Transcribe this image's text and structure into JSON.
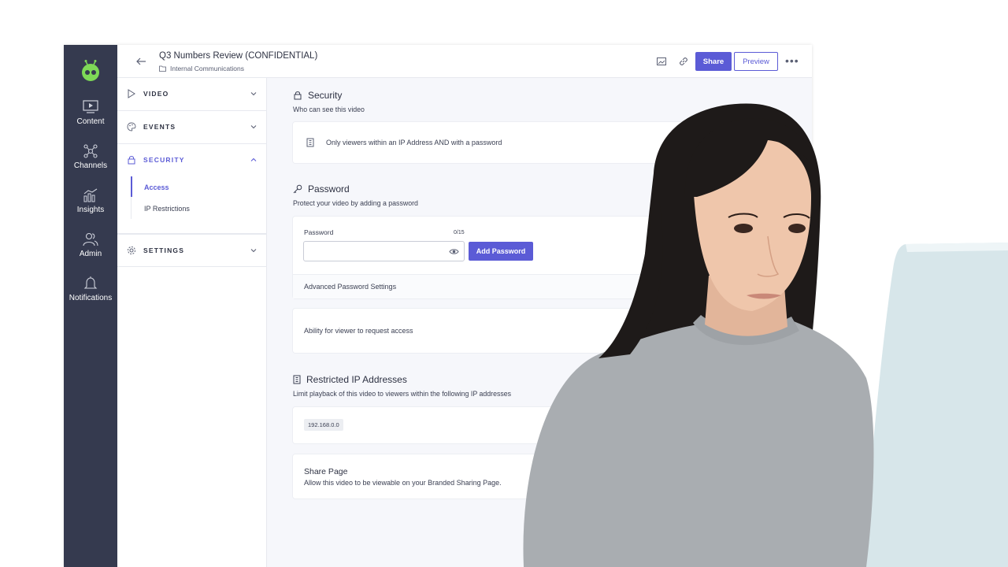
{
  "window": {
    "title": "Q3 Numbers Review (CONFIDENTIAL)",
    "folder": "Internal Communications"
  },
  "toolbar": {
    "share_label": "Share",
    "preview_label": "Preview",
    "more_label": "•••"
  },
  "rail": {
    "items": [
      {
        "label": "Content",
        "icon": "content-icon"
      },
      {
        "label": "Channels",
        "icon": "channels-icon"
      },
      {
        "label": "Insights",
        "icon": "insights-icon"
      },
      {
        "label": "Admin",
        "icon": "admin-icon"
      },
      {
        "label": "Notifications",
        "icon": "bell-icon"
      }
    ]
  },
  "sidebar": {
    "sections": [
      {
        "label": "VIDEO",
        "icon": "play-icon",
        "expanded": false
      },
      {
        "label": "EVENTS",
        "icon": "palette-icon",
        "expanded": false
      },
      {
        "label": "SECURITY",
        "icon": "lock-icon",
        "expanded": true
      },
      {
        "label": "SETTINGS",
        "icon": "gear-icon",
        "expanded": false
      }
    ],
    "security_items": [
      {
        "label": "Access",
        "active": true
      },
      {
        "label": "IP Restrictions",
        "active": false
      }
    ]
  },
  "main": {
    "security": {
      "title": "Security",
      "subtitle": "Who can see this video",
      "option": "Only viewers within an IP Address AND with a password"
    },
    "password": {
      "title": "Password",
      "subtitle": "Protect your video by adding a password",
      "field_label": "Password",
      "counter": "0/15",
      "value": "",
      "add_label": "Add Password",
      "advanced_label": "Advanced Password Settings",
      "request_access_label": "Ability for viewer to request access"
    },
    "ip": {
      "title": "Restricted IP Addresses",
      "subtitle": "Limit playback of this video to viewers within the following IP addresses",
      "addresses": [
        "192.168.0.0"
      ]
    },
    "share_page": {
      "title": "Share Page",
      "subtitle": "Allow this video to be viewable on your Branded Sharing Page."
    }
  },
  "colors": {
    "accent": "#5b5bd6",
    "rail": "#353a4f",
    "logo": "#7ed957"
  }
}
